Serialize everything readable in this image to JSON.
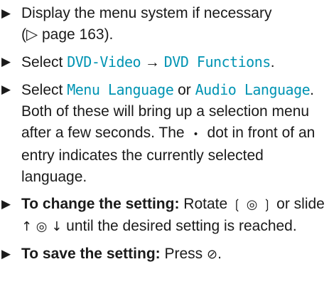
{
  "step1": {
    "text": "Display the menu system if necessary",
    "ref": "(▷ page 163)."
  },
  "step2": {
    "prefix": "Select ",
    "menu1": "DVD-Video",
    "arrow": " → ",
    "menu2": "DVD Functions",
    "suffix": "."
  },
  "step3": {
    "prefix": "Select ",
    "opt1": "Menu Language",
    "or": " or ",
    "opt2": "Audio Language",
    "suffix": "."
  },
  "note": {
    "part1": "Both of these will bring up a selection menu after a few seconds. The",
    "dot": "•",
    "part2": "dot in front of an entry indicates the currently selected language."
  },
  "step4": {
    "bold": "To change the setting:",
    "t1": " Rotate ",
    "rot": "❲ ◎ ❳",
    "t2": " or slide ",
    "slide": "↑ ◎ ↓",
    "t3": " until the desired setting is reached."
  },
  "step5": {
    "bold": "To save the setting:",
    "t1": " Press ",
    "press": "⊘",
    "t2": "."
  },
  "bullet": "▶"
}
